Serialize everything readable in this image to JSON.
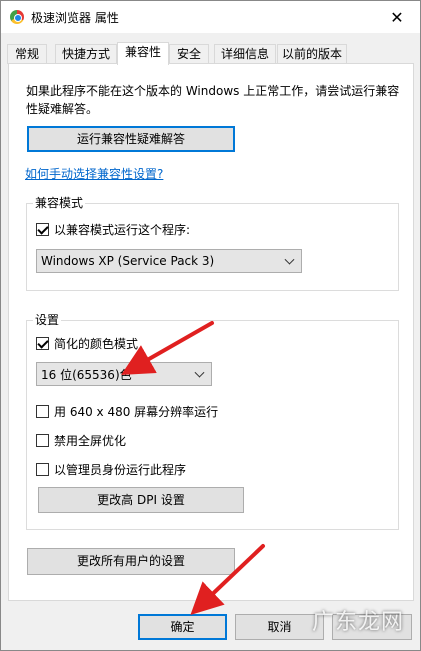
{
  "window": {
    "title": "极速浏览器 属性",
    "close_glyph": "✕"
  },
  "tabs": [
    "常规",
    "快捷方式",
    "兼容性",
    "安全",
    "详细信息",
    "以前的版本"
  ],
  "compat": {
    "intro": "如果此程序不能在这个版本的 Windows 上正常工作，请尝试运行兼容性疑难解答。",
    "troubleshoot_button": "运行兼容性疑难解答",
    "manual_link": "如何手动选择兼容性设置?"
  },
  "compat_mode": {
    "group_label": "兼容模式",
    "checkbox_label": "以兼容模式运行这个程序:",
    "checked": true,
    "os_select_value": "Windows XP (Service Pack 3)"
  },
  "settings": {
    "group_label": "设置",
    "reduced_color_label": "简化的颜色模式",
    "reduced_color_checked": true,
    "color_select_value": "16 位(65536)色",
    "res_640_label": "用 640 x 480 屏幕分辨率运行",
    "res_640_checked": false,
    "disable_fullscreen_label": "禁用全屏优化",
    "disable_fullscreen_checked": false,
    "run_admin_label": "以管理员身份运行此程序",
    "run_admin_checked": false,
    "dpi_button": "更改高 DPI 设置"
  },
  "all_users_button": "更改所有用户的设置",
  "footer": {
    "ok": "确定",
    "cancel": "取消"
  },
  "watermark": "广东龙网",
  "annotation_color": "#e02020"
}
